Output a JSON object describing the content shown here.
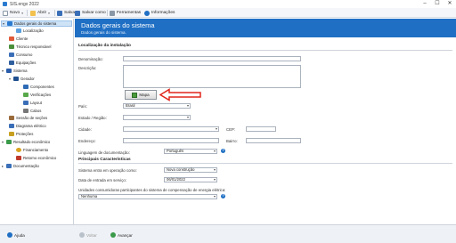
{
  "window": {
    "title": "SIS.engx 2022",
    "minimize": "–",
    "maximize": "☐",
    "close": "✕"
  },
  "toolbar": {
    "new_label": "Novo",
    "open_label": "Abrir",
    "save_label": "Salvar",
    "save_as_label": "Salvar como",
    "tools_label": "Ferramentas",
    "info_label": "Informações"
  },
  "sidebar": {
    "items": [
      {
        "label": "Dados gerais do sistema",
        "selected": true
      },
      {
        "label": "Localização"
      },
      {
        "label": "Cliente"
      },
      {
        "label": "Técnico responsável"
      },
      {
        "label": "Consumo"
      },
      {
        "label": "Equipações"
      },
      {
        "label": "Sistema"
      },
      {
        "label": "Gerador"
      },
      {
        "label": "Componentes"
      },
      {
        "label": "Verificações"
      },
      {
        "label": "Layout"
      },
      {
        "label": "Cabos"
      },
      {
        "label": "Sessão de seções"
      },
      {
        "label": "Diagrama elétrico"
      },
      {
        "label": "Proteções"
      },
      {
        "label": "Resultado econômico"
      },
      {
        "label": "Financiamento"
      },
      {
        "label": "Retorno econômico"
      },
      {
        "label": "Documentação"
      }
    ]
  },
  "header": {
    "title": "Dados gerais do sistema",
    "subtitle": "Dados gerais do sistema."
  },
  "installation": {
    "section_title": "Localização da instalação",
    "denomination_label": "Denominação:",
    "description_label": "Descrição:",
    "map_button": "Mapa",
    "country_label": "País:",
    "country_value": "Brasil",
    "state_label": "Estado / Região:",
    "city_label": "Cidade:",
    "cep_label": "CEP:",
    "address_label": "Endereço:",
    "district_label": "Bairro:",
    "doc_language_label": "Linguagem de documentação:",
    "doc_language_value": "Português"
  },
  "characteristics": {
    "section_title": "Principais Características",
    "operation_label": "Sistema entra em operação como:",
    "operation_value": "Nova construção",
    "service_date_label": "Data de entrada em serviço:",
    "service_date_value": "06/01/2022",
    "consumer_units_label": "Unidades consumidoras participantes do sistema de compensação de energia elétrica:",
    "consumer_units_value": "Nenhuma"
  },
  "bottom": {
    "help_label": "Ajuda",
    "back_label": "Voltar",
    "next_label": "Avançar"
  },
  "colors": {
    "accent": "#1f6fc4",
    "arrow": "#e0261b"
  }
}
